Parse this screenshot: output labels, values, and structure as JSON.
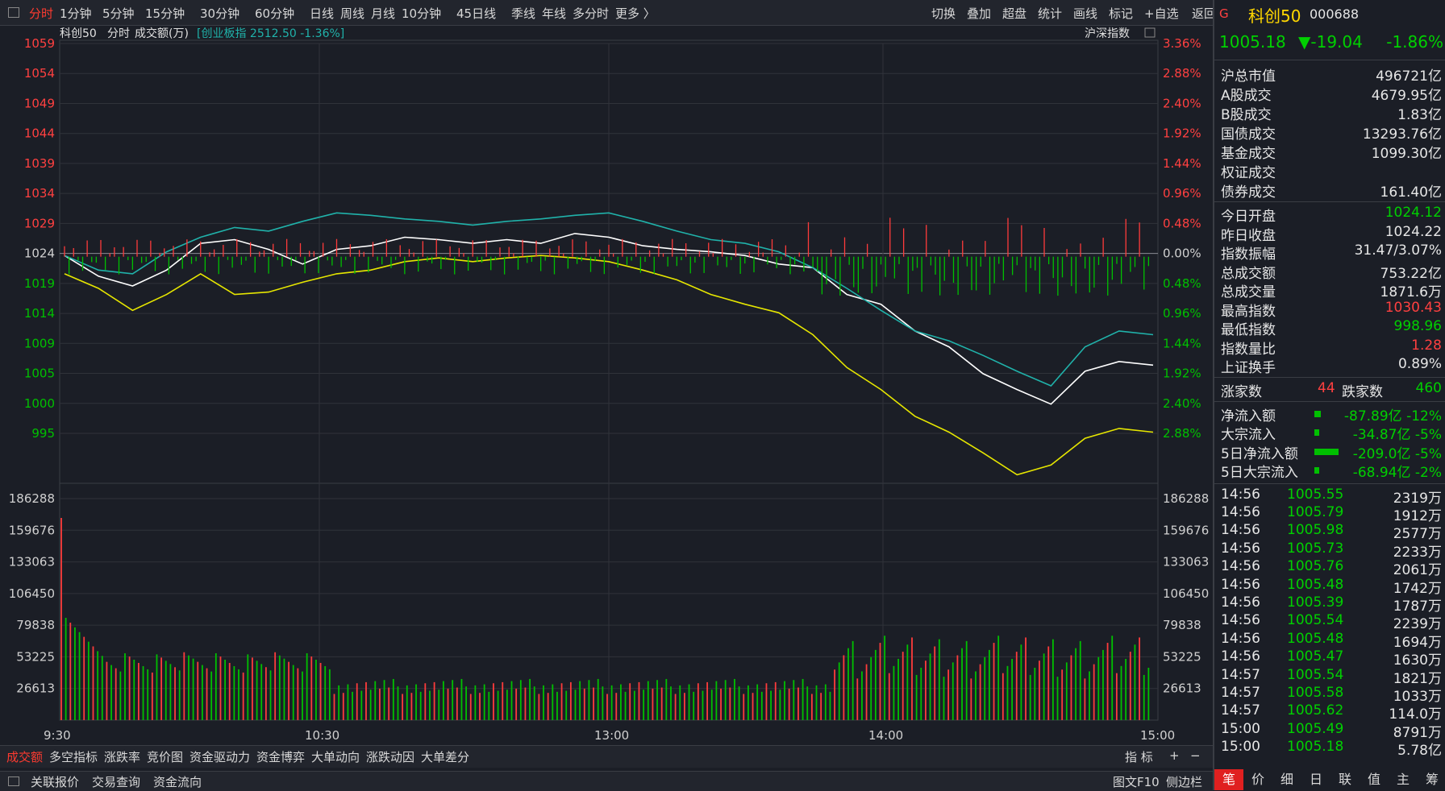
{
  "topbar": {
    "periods": [
      "分时",
      "1分钟",
      "5分钟",
      "15分钟",
      "30分钟",
      "60分钟",
      "日线",
      "周线",
      "月线",
      "10分钟",
      "45日线",
      "季线",
      "年线",
      "多分时",
      "更多 〉"
    ],
    "active": "分时",
    "tools": [
      "切换",
      "叠加",
      "超盘",
      "统计",
      "画线",
      "标记",
      "+自选",
      "返回"
    ]
  },
  "chart": {
    "name": "科创50",
    "mode": "分时",
    "volume_label": "成交额(万)",
    "overlay": "[创业板指 2512.50 -1.36%]",
    "overlay_index": "沪深指数",
    "price_ticks": [
      "1059",
      "1054",
      "1049",
      "1044",
      "1039",
      "1034",
      "1029",
      "1024",
      "1019",
      "1014",
      "1009",
      "1005",
      "1000",
      "995"
    ],
    "pct_ticks": [
      "3.36%",
      "2.88%",
      "2.40%",
      "1.92%",
      "1.44%",
      "0.96%",
      "0.48%",
      "0.00%",
      "0.48%",
      "0.96%",
      "1.44%",
      "1.92%",
      "2.40%",
      "2.88%"
    ],
    "vol_ticks": [
      "186288",
      "159676",
      "133063",
      "106450",
      "79838",
      "53225",
      "26613"
    ],
    "time_ticks": [
      "9:30",
      "10:30",
      "13:00",
      "14:00",
      "15:00"
    ],
    "colors": {
      "up": "#ff3b3b",
      "down": "#00c000",
      "price_line": "#ffffff",
      "avg_line": "#e6e600",
      "overlay_line": "#20b2aa"
    }
  },
  "chart_data": {
    "type": "line",
    "title": "科创50 分时",
    "x": [
      "9:30",
      "10:30",
      "13:00",
      "14:00",
      "15:00"
    ],
    "price_range": [
      995,
      1059
    ],
    "prev_close": 1024.22,
    "series": [
      {
        "name": "科创50",
        "values": [
          1024,
          1021,
          1019,
          1022,
          1026,
          1027,
          1025,
          1023,
          1025,
          1026,
          1027,
          1027,
          1026,
          1027,
          1026,
          1028,
          1027,
          1026,
          1025,
          1025,
          1024,
          1023,
          1022,
          1018,
          1016,
          1012,
          1009,
          1005,
          1002,
          1000,
          1005,
          1007,
          1006
        ]
      },
      {
        "name": "均价",
        "values": [
          1021,
          1019,
          1015,
          1018,
          1021,
          1018,
          1018,
          1020,
          1021,
          1022,
          1023,
          1024,
          1023,
          1024,
          1024,
          1024,
          1023,
          1022,
          1020,
          1018,
          1016,
          1015,
          1011,
          1006,
          1002,
          998,
          995,
          992,
          988,
          990,
          994,
          996,
          995
        ]
      },
      {
        "name": "创业板指",
        "values": [
          1024,
          1022,
          1021,
          1025,
          1027,
          1029,
          1028,
          1030,
          1031,
          1031,
          1030,
          1030,
          1029,
          1030,
          1030,
          1031,
          1031,
          1030,
          1028,
          1027,
          1026,
          1025,
          1022,
          1019,
          1015,
          1012,
          1010,
          1008,
          1005,
          1003,
          1009,
          1012,
          1011
        ]
      }
    ],
    "volume_range": [
      0,
      186288
    ]
  },
  "tabs": [
    "成交额",
    "多空指标",
    "涨跌率",
    "竞价图",
    "资金驱动力",
    "资金博弈",
    "大单动向",
    "涨跌动因",
    "大单差分"
  ],
  "active_tab": "成交额",
  "tab_right": [
    "指 标",
    "+",
    "−"
  ],
  "bottombar": [
    "关联报价",
    "交易查询",
    "资金流向"
  ],
  "bottom_right": [
    "图文F10",
    "侧边栏"
  ],
  "side": {
    "badge": "G",
    "name": "科创50",
    "code": "000688",
    "price": "1005.18",
    "change": "▼-19.04",
    "change_pct": "-1.86%",
    "block1": [
      {
        "k": "沪总市值",
        "v": "496721亿"
      },
      {
        "k": "A股成交",
        "v": "4679.95亿"
      },
      {
        "k": "B股成交",
        "v": "1.83亿"
      },
      {
        "k": "国债成交",
        "v": "13293.76亿"
      },
      {
        "k": "基金成交",
        "v": "1099.30亿"
      },
      {
        "k": "权证成交",
        "v": ""
      },
      {
        "k": "债券成交",
        "v": "161.40亿"
      }
    ],
    "block2": [
      {
        "k": "今日开盘",
        "v": "1024.12",
        "c": "green"
      },
      {
        "k": "昨日收盘",
        "v": "1024.22",
        "c": ""
      },
      {
        "k": "指数振幅",
        "v": "31.47/3.07%",
        "c": ""
      },
      {
        "k": "总成交额",
        "v": "753.22亿",
        "c": ""
      },
      {
        "k": "总成交量",
        "v": "1871.6万",
        "c": ""
      },
      {
        "k": "最高指数",
        "v": "1030.43",
        "c": "red"
      },
      {
        "k": "最低指数",
        "v": "998.96",
        "c": "green"
      },
      {
        "k": "指数量比",
        "v": "1.28",
        "c": "red"
      },
      {
        "k": "上证换手",
        "v": "0.89%",
        "c": ""
      }
    ],
    "rise_label": "涨家数",
    "rise": "44",
    "fall_label": "跌家数",
    "fall": "460",
    "flows": [
      {
        "k": "净流入额",
        "v": "-87.89亿 -12%",
        "bar": 0.08
      },
      {
        "k": "大宗流入",
        "v": "-34.87亿 -5%",
        "bar": 0.03
      },
      {
        "k": "5日净流入额",
        "v": "-209.0亿 -5%",
        "bar": 0.3
      },
      {
        "k": "5日大宗流入",
        "v": "-68.94亿 -2%",
        "bar": 0.06
      }
    ],
    "ticks": [
      {
        "t": "14:56",
        "p": "1005.55",
        "v": "2319万"
      },
      {
        "t": "14:56",
        "p": "1005.79",
        "v": "1912万"
      },
      {
        "t": "14:56",
        "p": "1005.98",
        "v": "2577万"
      },
      {
        "t": "14:56",
        "p": "1005.73",
        "v": "2233万"
      },
      {
        "t": "14:56",
        "p": "1005.76",
        "v": "2061万"
      },
      {
        "t": "14:56",
        "p": "1005.48",
        "v": "1742万"
      },
      {
        "t": "14:56",
        "p": "1005.39",
        "v": "1787万"
      },
      {
        "t": "14:56",
        "p": "1005.54",
        "v": "2239万"
      },
      {
        "t": "14:56",
        "p": "1005.48",
        "v": "1694万"
      },
      {
        "t": "14:56",
        "p": "1005.47",
        "v": "1630万"
      },
      {
        "t": "14:57",
        "p": "1005.54",
        "v": "1821万"
      },
      {
        "t": "14:57",
        "p": "1005.58",
        "v": "1033万"
      },
      {
        "t": "14:57",
        "p": "1005.62",
        "v": "114.0万"
      },
      {
        "t": "15:00",
        "p": "1005.49",
        "v": "8791万"
      },
      {
        "t": "15:00",
        "p": "1005.18",
        "v": "5.78亿"
      }
    ],
    "side_tabs": [
      "笔",
      "价",
      "细",
      "日",
      "联",
      "值",
      "主",
      "筹"
    ]
  }
}
